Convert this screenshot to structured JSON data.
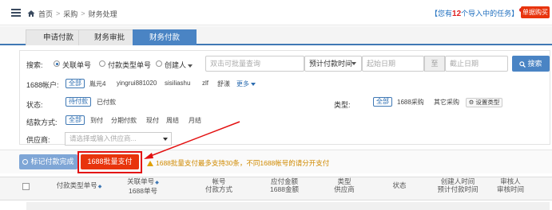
{
  "header": {
    "home": "首页",
    "crumb1": "采购",
    "crumb2": "财务处理",
    "task_prefix": "【您有",
    "task_count": "12",
    "task_suffix": "个导入中的任务】",
    "buy_label": "单据购买"
  },
  "tabs": [
    "申请付款",
    "财务审批",
    "财务付款"
  ],
  "active_tab": "财务付款",
  "search": {
    "label": "搜索:",
    "options": [
      "关联单号",
      "付款类型单号",
      "创建人"
    ],
    "selected": "关联单号",
    "query_placeholder": "双击可批量查询",
    "time_select": "预计付款时间",
    "start_placeholder": "起始日期",
    "to_label": "至",
    "end_placeholder": "截止日期",
    "button": "搜索"
  },
  "accounts": {
    "label": "1688帐户:",
    "all": "全部",
    "items": [
      "胤元4",
      "yingrui881020",
      "sisiliashu",
      "zlf",
      "舒漾"
    ],
    "more": "更多"
  },
  "status": {
    "label": "状态:",
    "items": [
      "待付款",
      "已付款"
    ]
  },
  "type": {
    "label": "类型:",
    "items": [
      "全部",
      "1688采购",
      "其它采购"
    ],
    "settings": "设置类型"
  },
  "settlement": {
    "label": "结款方式:",
    "items": [
      "全部",
      "到付",
      "分期付款",
      "现付",
      "周结",
      "月结"
    ]
  },
  "supplier": {
    "label": "供应商:",
    "placeholder": "请选择或输入供应商..."
  },
  "actions": {
    "mark_done": "标记付款完成",
    "batch_pay": "1688批量支付",
    "warning": "1688批量支付最多支持30条，不同1688帐号的请分开支付"
  },
  "table_headers": [
    [
      "付款类型单号",
      ""
    ],
    [
      "关联单号",
      "1688单号"
    ],
    [
      "帐号",
      "付款方式"
    ],
    [
      "应付金额",
      "1688金额"
    ],
    [
      "类型",
      "供应商"
    ],
    [
      "状态",
      ""
    ],
    [
      "创建人时间",
      "预计付款时间"
    ],
    [
      "审核人",
      "审核时间"
    ]
  ],
  "colors": {
    "accent": "#4a84c4",
    "danger": "#e8340c",
    "highlight_border": "#e31010",
    "warning": "#d08a00"
  }
}
